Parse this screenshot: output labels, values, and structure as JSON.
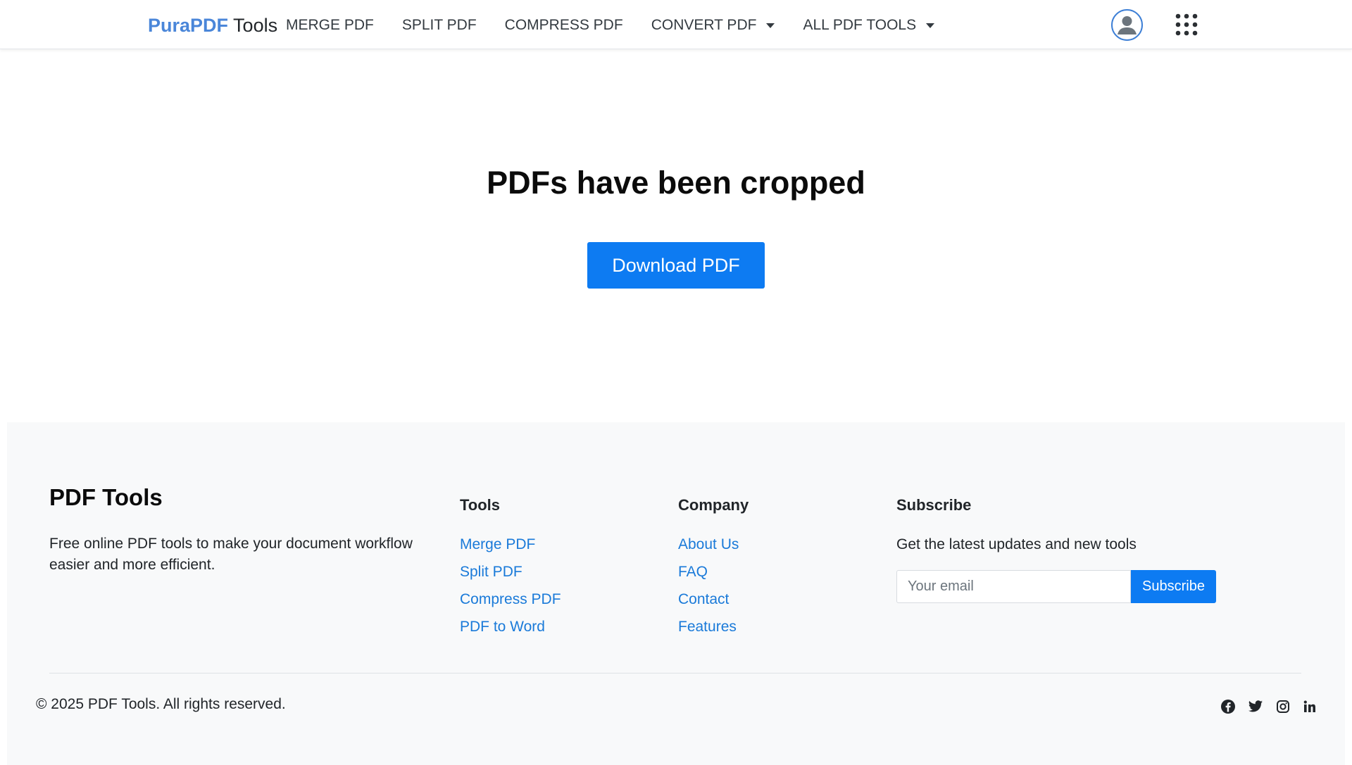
{
  "nav": {
    "brand_part1": "PuraPDF",
    "brand_part2": "Tools",
    "items": [
      {
        "label": "MERGE PDF"
      },
      {
        "label": "SPLIT PDF"
      },
      {
        "label": "COMPRESS PDF"
      },
      {
        "label": "CONVERT PDF"
      },
      {
        "label": "ALL PDF TOOLS"
      }
    ],
    "icons": [
      "user-avatar-icon",
      "apps-grid-icon",
      "caret-down-icon"
    ]
  },
  "main": {
    "title": "PDFs have been cropped",
    "download_label": "Download PDF"
  },
  "footer": {
    "brand": "PDF Tools",
    "description": "Free online PDF tools to make your document workflow easier and more efficient.",
    "tools": {
      "title": "Tools",
      "links": [
        "Merge PDF",
        "Split PDF",
        "Compress PDF",
        "PDF to Word"
      ]
    },
    "company": {
      "title": "Company",
      "links": [
        "About Us",
        "FAQ",
        "Contact",
        "Features"
      ]
    },
    "subscribe": {
      "title": "Subscribe",
      "text": "Get the latest updates and new tools",
      "placeholder": "Your email",
      "button": "Subscribe"
    },
    "copyright": "© 2025 PDF Tools. All rights reserved.",
    "social_icons": [
      "facebook-icon",
      "twitter-icon",
      "instagram-icon",
      "linkedin-icon"
    ]
  },
  "colors": {
    "accent": "#0d7bf2",
    "link": "#1a7ad9",
    "brand_blue": "#4a86d9",
    "footer_bg": "#f8f9fa"
  }
}
